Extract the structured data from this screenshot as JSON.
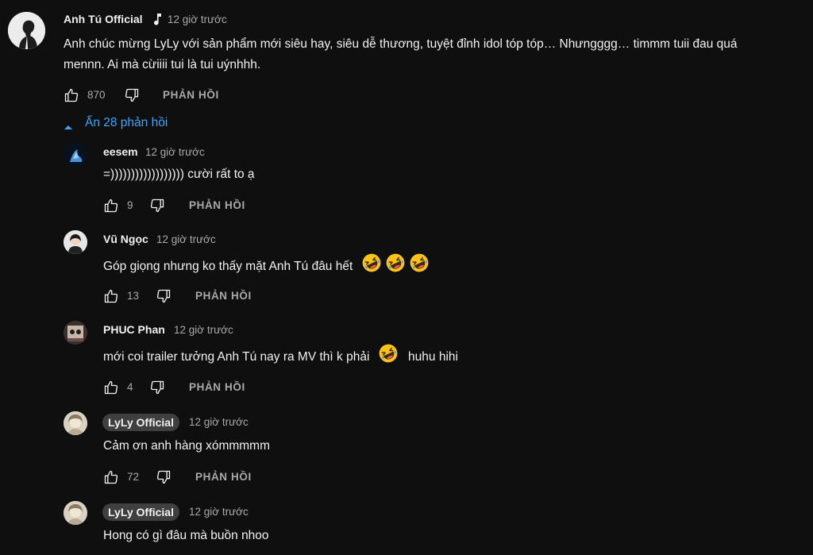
{
  "top_comment": {
    "author": "Anh Tú Official",
    "time": "12 giờ trước",
    "text_line1": "Anh chúc mừng LyLy với sản phẩm mới siêu hay, siêu dễ thương, tuyệt đỉnh idol tóp tóp… Nhưngggg… timmm tuii đau quá",
    "text_line2": "mennn. Ai mà cừiiii tui là tui uýnhhh.",
    "likes": "870",
    "reply_label": "PHẢN HỒI"
  },
  "toggle_replies_label": "Ẩn 28 phản hồi",
  "replies": [
    {
      "author": "eesem",
      "time": "12 giờ trước",
      "text": "=)))))))))))))))))) cười rất to ạ",
      "likes": "9",
      "reply_label": "PHẢN HỒI"
    },
    {
      "author": "Vũ Ngọc",
      "time": "12 giờ trước",
      "text": "Góp giọng nhưng ko thấy mặt Anh Tú đâu hết",
      "likes": "13",
      "reply_label": "PHẢN HỒI",
      "emoji": "rofl"
    },
    {
      "author": "PHUC Phan",
      "time": "12 giờ trước",
      "text": "mới coi trailer tưởng Anh Tú nay ra MV thì k phải",
      "text_after_emoji": "huhu hihi",
      "likes": "4",
      "reply_label": "PHẢN HỒI",
      "emoji": "rofl"
    },
    {
      "author": "LyLy Official",
      "time": "12 giờ trước",
      "text": "Cảm ơn anh hàng xómmmmm",
      "likes": "72",
      "reply_label": "PHẢN HỒI"
    },
    {
      "author": "LyLy Official",
      "time": "12 giờ trước",
      "text": "Hong có gì đâu mà buồn nhoo"
    }
  ],
  "colors": {
    "background": "#0f0f0f",
    "text": "#f1f1f1",
    "secondary": "#aaaaaa",
    "link": "#3ea6ff",
    "badge": "#3f3f3f"
  },
  "icons": [
    "music-note-icon",
    "thumbs-up-icon",
    "thumbs-down-icon",
    "caret-up-icon",
    "rofl-emoji-icon"
  ]
}
